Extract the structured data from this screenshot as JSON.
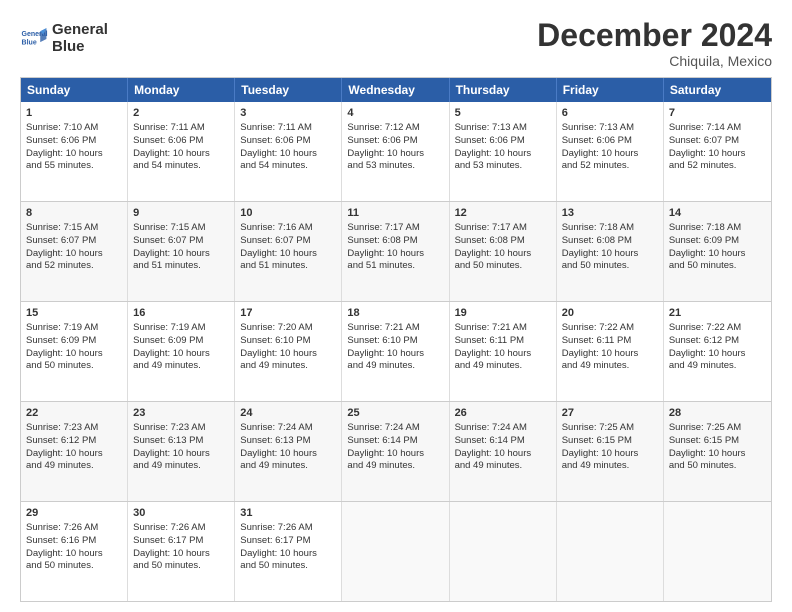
{
  "logo": {
    "line1": "General",
    "line2": "Blue"
  },
  "title": "December 2024",
  "subtitle": "Chiquila, Mexico",
  "days": [
    "Sunday",
    "Monday",
    "Tuesday",
    "Wednesday",
    "Thursday",
    "Friday",
    "Saturday"
  ],
  "weeks": [
    [
      {
        "day": "1",
        "rise": "7:10 AM",
        "set": "6:06 PM",
        "hours": "10 hours",
        "minutes": "55 minutes"
      },
      {
        "day": "2",
        "rise": "7:11 AM",
        "set": "6:06 PM",
        "hours": "10 hours",
        "minutes": "54 minutes"
      },
      {
        "day": "3",
        "rise": "7:11 AM",
        "set": "6:06 PM",
        "hours": "10 hours",
        "minutes": "54 minutes"
      },
      {
        "day": "4",
        "rise": "7:12 AM",
        "set": "6:06 PM",
        "hours": "10 hours",
        "minutes": "53 minutes"
      },
      {
        "day": "5",
        "rise": "7:13 AM",
        "set": "6:06 PM",
        "hours": "10 hours",
        "minutes": "53 minutes"
      },
      {
        "day": "6",
        "rise": "7:13 AM",
        "set": "6:06 PM",
        "hours": "10 hours",
        "minutes": "52 minutes"
      },
      {
        "day": "7",
        "rise": "7:14 AM",
        "set": "6:07 PM",
        "hours": "10 hours",
        "minutes": "52 minutes"
      }
    ],
    [
      {
        "day": "8",
        "rise": "7:15 AM",
        "set": "6:07 PM",
        "hours": "10 hours",
        "minutes": "52 minutes"
      },
      {
        "day": "9",
        "rise": "7:15 AM",
        "set": "6:07 PM",
        "hours": "10 hours",
        "minutes": "51 minutes"
      },
      {
        "day": "10",
        "rise": "7:16 AM",
        "set": "6:07 PM",
        "hours": "10 hours",
        "minutes": "51 minutes"
      },
      {
        "day": "11",
        "rise": "7:17 AM",
        "set": "6:08 PM",
        "hours": "10 hours",
        "minutes": "51 minutes"
      },
      {
        "day": "12",
        "rise": "7:17 AM",
        "set": "6:08 PM",
        "hours": "10 hours",
        "minutes": "50 minutes"
      },
      {
        "day": "13",
        "rise": "7:18 AM",
        "set": "6:08 PM",
        "hours": "10 hours",
        "minutes": "50 minutes"
      },
      {
        "day": "14",
        "rise": "7:18 AM",
        "set": "6:09 PM",
        "hours": "10 hours",
        "minutes": "50 minutes"
      }
    ],
    [
      {
        "day": "15",
        "rise": "7:19 AM",
        "set": "6:09 PM",
        "hours": "10 hours",
        "minutes": "50 minutes"
      },
      {
        "day": "16",
        "rise": "7:19 AM",
        "set": "6:09 PM",
        "hours": "10 hours",
        "minutes": "49 minutes"
      },
      {
        "day": "17",
        "rise": "7:20 AM",
        "set": "6:10 PM",
        "hours": "10 hours",
        "minutes": "49 minutes"
      },
      {
        "day": "18",
        "rise": "7:21 AM",
        "set": "6:10 PM",
        "hours": "10 hours",
        "minutes": "49 minutes"
      },
      {
        "day": "19",
        "rise": "7:21 AM",
        "set": "6:11 PM",
        "hours": "10 hours",
        "minutes": "49 minutes"
      },
      {
        "day": "20",
        "rise": "7:22 AM",
        "set": "6:11 PM",
        "hours": "10 hours",
        "minutes": "49 minutes"
      },
      {
        "day": "21",
        "rise": "7:22 AM",
        "set": "6:12 PM",
        "hours": "10 hours",
        "minutes": "49 minutes"
      }
    ],
    [
      {
        "day": "22",
        "rise": "7:23 AM",
        "set": "6:12 PM",
        "hours": "10 hours",
        "minutes": "49 minutes"
      },
      {
        "day": "23",
        "rise": "7:23 AM",
        "set": "6:13 PM",
        "hours": "10 hours",
        "minutes": "49 minutes"
      },
      {
        "day": "24",
        "rise": "7:24 AM",
        "set": "6:13 PM",
        "hours": "10 hours",
        "minutes": "49 minutes"
      },
      {
        "day": "25",
        "rise": "7:24 AM",
        "set": "6:14 PM",
        "hours": "10 hours",
        "minutes": "49 minutes"
      },
      {
        "day": "26",
        "rise": "7:24 AM",
        "set": "6:14 PM",
        "hours": "10 hours",
        "minutes": "49 minutes"
      },
      {
        "day": "27",
        "rise": "7:25 AM",
        "set": "6:15 PM",
        "hours": "10 hours",
        "minutes": "49 minutes"
      },
      {
        "day": "28",
        "rise": "7:25 AM",
        "set": "6:15 PM",
        "hours": "10 hours",
        "minutes": "50 minutes"
      }
    ],
    [
      {
        "day": "29",
        "rise": "7:26 AM",
        "set": "6:16 PM",
        "hours": "10 hours",
        "minutes": "50 minutes"
      },
      {
        "day": "30",
        "rise": "7:26 AM",
        "set": "6:17 PM",
        "hours": "10 hours",
        "minutes": "50 minutes"
      },
      {
        "day": "31",
        "rise": "7:26 AM",
        "set": "6:17 PM",
        "hours": "10 hours",
        "minutes": "50 minutes"
      },
      null,
      null,
      null,
      null
    ]
  ],
  "labels": {
    "sunrise": "Sunrise:",
    "sunset": "Sunset:",
    "daylight": "Daylight:"
  }
}
